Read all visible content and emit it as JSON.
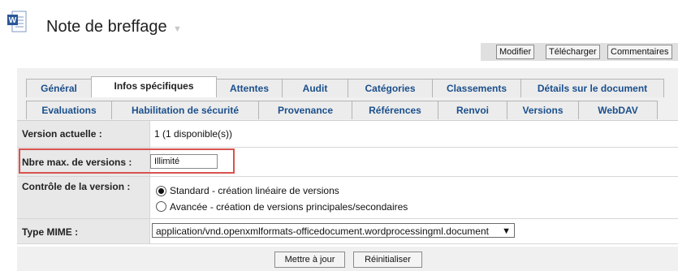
{
  "header": {
    "title": "Note de breffage",
    "doc_icon": "word-document-icon",
    "caret_icon": "chevron-down-icon"
  },
  "toolbar": {
    "modify": "Modifier",
    "download": "Télécharger",
    "comments": "Commentaires"
  },
  "tabs_row1": [
    "Général",
    "Infos spécifiques",
    "Attentes",
    "Audit",
    "Catégories",
    "Classements",
    "Détails sur le document"
  ],
  "tabs_row2": [
    "Evaluations",
    "Habilitation de sécurité",
    "Provenance",
    "Références",
    "Renvoi",
    "Versions",
    "WebDAV"
  ],
  "active_tab": "Infos spécifiques",
  "form": {
    "current_version_label": "Version actuelle :",
    "current_version_value": "1 (1 disponible(s))",
    "max_versions_label": "Nbre max. de versions :",
    "max_versions_value": "Illimité",
    "version_control_label": "Contrôle de la version :",
    "version_control_options": [
      {
        "label": "Standard - création linéaire de versions",
        "selected": true
      },
      {
        "label": "Avancée - création de versions principales/secondaires",
        "selected": false
      }
    ],
    "mime_label": "Type MIME :",
    "mime_value": "application/vnd.openxmlformats-officedocument.wordprocessingml.document"
  },
  "actions": {
    "update": "Mettre à jour",
    "reset": "Réinitialiser"
  },
  "colors": {
    "tab_text": "#1a4f8c",
    "highlight_border": "#d9534f",
    "label_bg": "#e8e8e8"
  }
}
